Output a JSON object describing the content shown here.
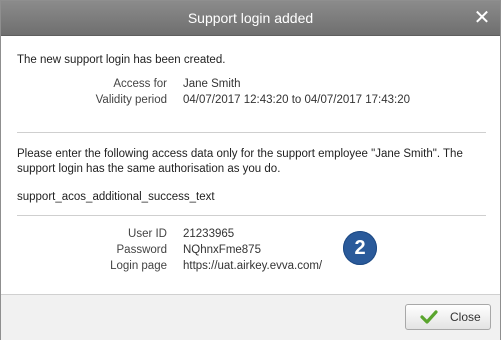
{
  "dialog": {
    "title": "Support login added",
    "close_icon": "close-icon",
    "intro": "The new support login has been created.",
    "access_for_label": "Access for",
    "access_for_value": "Jane Smith",
    "validity_label": "Validity period",
    "validity_value": "04/07/2017 12:43:20 to 04/07/2017 17:43:20",
    "instructions": "Please enter the following access data only for the support employee \"Jane Smith\". The support login has the same authorisation as you do.",
    "additional_text": "support_acos_additional_success_text",
    "user_id_label": "User ID",
    "user_id_value": "21233965",
    "password_label": "Password",
    "password_value": "NQhnxFme875",
    "login_page_label": "Login page",
    "login_page_value": "https://uat.airkey.evva.com/",
    "badge_number": "2",
    "close_button_label": "Close",
    "check_icon": "check-icon"
  },
  "colors": {
    "titlebar": "#7d7d7d",
    "badge": "#2a5a9a",
    "check": "#5aa52e"
  }
}
